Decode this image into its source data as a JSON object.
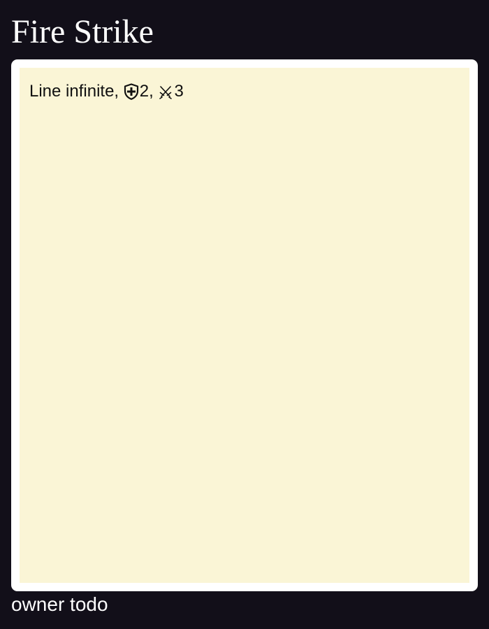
{
  "card": {
    "title": "Fire Strike",
    "rules": {
      "range_text": "Line infinite",
      "separator": ", ",
      "defense": {
        "icon": "shield-plus-icon",
        "value": "2"
      },
      "attack": {
        "icon": "crossed-swords-icon",
        "value": "3"
      }
    },
    "owner": "owner todo"
  }
}
